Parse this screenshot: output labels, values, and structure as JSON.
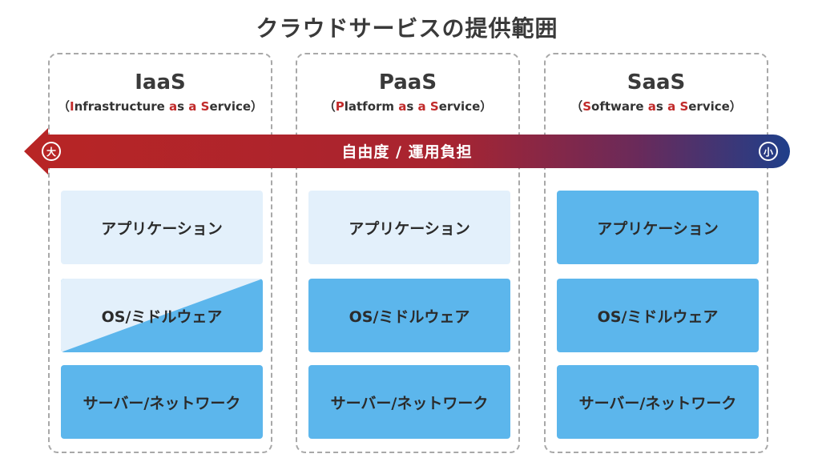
{
  "title": "クラウドサービスの提供範囲",
  "arrow": {
    "label": "自由度 / 運用負担",
    "left_badge": "大",
    "right_badge": "小",
    "colors": {
      "left": "#b82525",
      "right": "#1f3f8a"
    }
  },
  "columns": [
    {
      "name": "IaaS",
      "sub": [
        "（",
        "I",
        "nfrastructure ",
        "a",
        "s ",
        "a",
        " ",
        "S",
        "ervice）"
      ],
      "layers": [
        {
          "label": "アプリケーション",
          "style": "light"
        },
        {
          "label": "OS/ミドルウェア",
          "style": "split"
        },
        {
          "label": "サーバー/ネットワーク",
          "style": "dark"
        }
      ]
    },
    {
      "name": "PaaS",
      "sub": [
        "（",
        "P",
        "latform ",
        "a",
        "s ",
        "a",
        " ",
        "S",
        "ervice）"
      ],
      "layers": [
        {
          "label": "アプリケーション",
          "style": "light"
        },
        {
          "label": "OS/ミドルウェア",
          "style": "dark"
        },
        {
          "label": "サーバー/ネットワーク",
          "style": "dark"
        }
      ]
    },
    {
      "name": "SaaS",
      "sub": [
        "（",
        "S",
        "oftware ",
        "a",
        "s ",
        "a",
        " ",
        "S",
        "ervice）"
      ],
      "layers": [
        {
          "label": "アプリケーション",
          "style": "dark"
        },
        {
          "label": "OS/ミドルウェア",
          "style": "dark"
        },
        {
          "label": "サーバー/ネットワーク",
          "style": "dark"
        }
      ]
    }
  ],
  "colors": {
    "light": "#e3f0fb",
    "dark": "#5cb6ec",
    "accent": "#c12a2a"
  }
}
